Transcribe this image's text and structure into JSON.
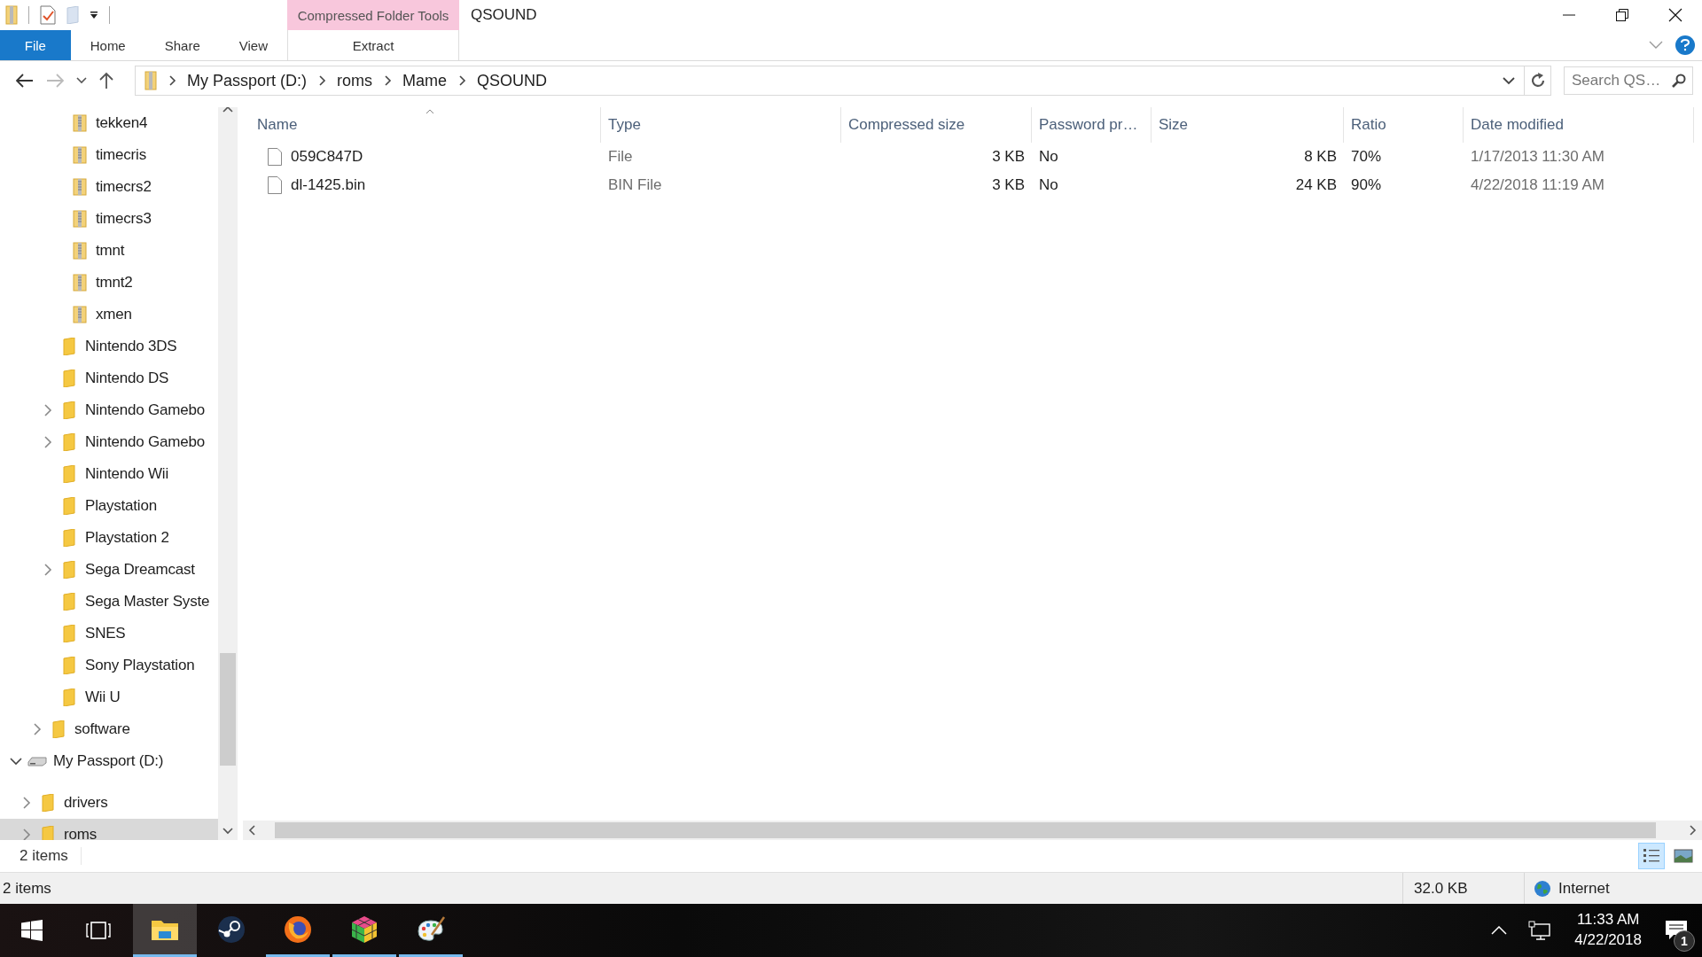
{
  "window": {
    "title": "QSOUND",
    "context_tab_group": "Compressed Folder Tools"
  },
  "ribbon_tabs": [
    {
      "label": "File",
      "kind": "file"
    },
    {
      "label": "Home",
      "kind": "normal"
    },
    {
      "label": "Share",
      "kind": "normal"
    },
    {
      "label": "View",
      "kind": "normal"
    },
    {
      "label": "Extract",
      "kind": "context"
    }
  ],
  "address_bar": {
    "segments": [
      "My Passport (D:)",
      "roms",
      "Mame",
      "QSOUND"
    ]
  },
  "search": {
    "placeholder": "Search QS…"
  },
  "navigation_tree": [
    {
      "children": [
        {
          "children": [
            {
              "children": [
                {
                  "children": [
                    {
                      "label": "tekken4",
                      "kind": "zip",
                      "selected": false
                    },
                    {
                      "label": "timecris",
                      "kind": "zip",
                      "selected": false
                    },
                    {
                      "label": "timecrs2",
                      "kind": "zip",
                      "selected": false
                    },
                    {
                      "label": "timecrs3",
                      "kind": "zip",
                      "selected": false
                    },
                    {
                      "label": "tmnt",
                      "kind": "zip",
                      "selected": false
                    },
                    {
                      "label": "tmnt2",
                      "kind": "zip",
                      "selected": false
                    },
                    {
                      "label": "xmen",
                      "kind": "zip",
                      "selected": false
                    }
                  ]
                },
                {
                  "label": "Nintendo 3DS",
                  "kind": "folder",
                  "selected": false
                },
                {
                  "label": "Nintendo DS",
                  "kind": "folder",
                  "selected": false
                },
                {
                  "label": "Nintendo Gamebo",
                  "kind": "folder",
                  "expanded": false,
                  "selected": false
                },
                {
                  "label": "Nintendo Gamebo",
                  "kind": "folder",
                  "expanded": false,
                  "selected": false
                },
                {
                  "label": "Nintendo Wii",
                  "kind": "folder",
                  "selected": false
                },
                {
                  "label": "Playstation",
                  "kind": "folder",
                  "selected": false
                },
                {
                  "label": "Playstation 2",
                  "kind": "folder",
                  "selected": false
                },
                {
                  "label": "Sega Dreamcast",
                  "kind": "folder",
                  "expanded": false,
                  "selected": false
                },
                {
                  "label": "Sega Master Syste",
                  "kind": "folder",
                  "selected": false
                },
                {
                  "label": "SNES",
                  "kind": "folder",
                  "selected": false
                },
                {
                  "label": "Sony Playstation",
                  "kind": "folder",
                  "selected": false
                },
                {
                  "label": "Wii U",
                  "kind": "folder",
                  "selected": false
                }
              ]
            },
            {
              "label": "software",
              "kind": "folder",
              "expanded": false,
              "selected": false
            }
          ]
        }
      ]
    },
    {
      "label": "My Passport (D:)",
      "kind": "drive",
      "expanded": true,
      "selected": false,
      "children": [
        {
          "label": "drivers",
          "kind": "folder",
          "expanded": false,
          "selected": false
        },
        {
          "label": "roms",
          "kind": "folder",
          "expanded": false,
          "selected": true
        }
      ]
    }
  ],
  "file_list": {
    "columns": [
      {
        "label": "Name",
        "sorted": true
      },
      {
        "label": "Type",
        "sorted": false
      },
      {
        "label": "Compressed size",
        "sorted": false
      },
      {
        "label": "Password pr…",
        "sorted": false
      },
      {
        "label": "Size",
        "sorted": false
      },
      {
        "label": "Ratio",
        "sorted": false
      },
      {
        "label": "Date modified",
        "sorted": false
      }
    ],
    "rows": [
      [
        "059C847D",
        "File",
        "3 KB",
        "No",
        "8 KB",
        "70%",
        "1/17/2013 11:30 AM"
      ],
      [
        "dl-1425.bin",
        "BIN File",
        "3 KB",
        "No",
        "24 KB",
        "90%",
        "4/22/2018 11:19 AM"
      ]
    ]
  },
  "status_bar": {
    "item_count": "2 items"
  },
  "outer_status_bar": {
    "item_count": "2 items",
    "size": "32.0 KB",
    "zone": "Internet"
  },
  "taskbar": {
    "apps": [
      {
        "kind": "explorer",
        "running": true,
        "active": true
      },
      {
        "kind": "steam",
        "running": false,
        "active": false
      },
      {
        "kind": "firefox",
        "running": true,
        "active": false
      },
      {
        "kind": "cube",
        "running": true,
        "active": false
      },
      {
        "kind": "paint",
        "running": true,
        "active": false
      }
    ],
    "time": "11:33 AM",
    "date": "4/22/2018",
    "notification_count": "1"
  }
}
